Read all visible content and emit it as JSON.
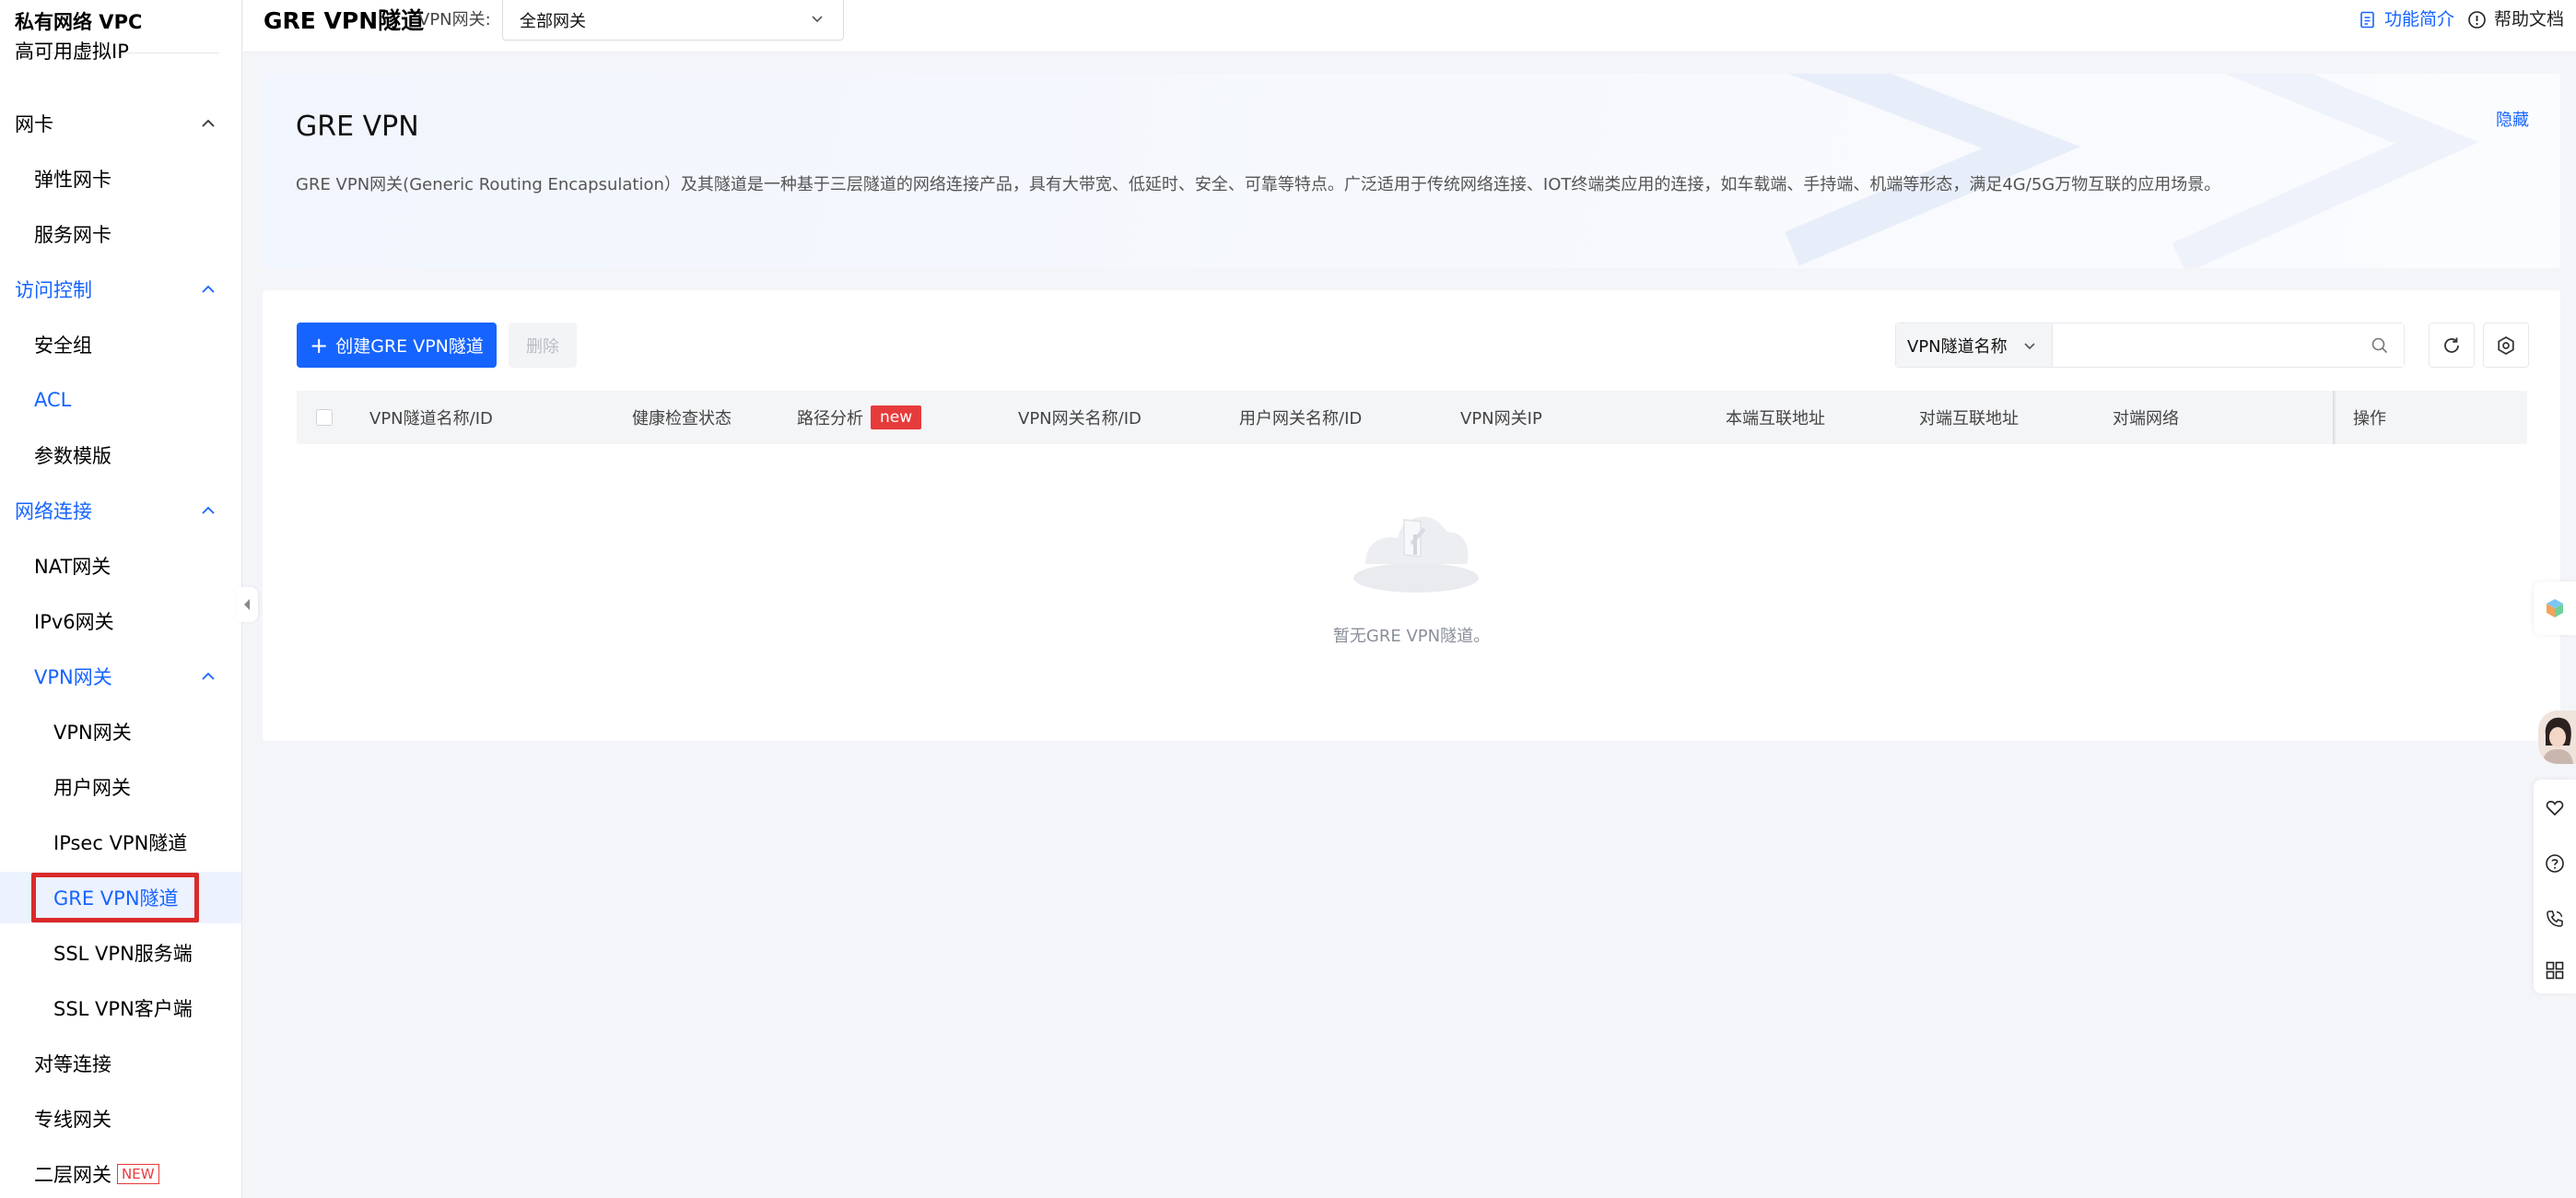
{
  "sidebar": {
    "title": "私有网络 VPC",
    "items": [
      {
        "label": "高可用虚拟IP"
      },
      {
        "label": "网卡"
      },
      {
        "label": "弹性网卡"
      },
      {
        "label": "服务网卡"
      },
      {
        "label": "访问控制"
      },
      {
        "label": "安全组"
      },
      {
        "label": "ACL"
      },
      {
        "label": "参数模版"
      },
      {
        "label": "网络连接"
      },
      {
        "label": "NAT网关"
      },
      {
        "label": "IPv6网关"
      },
      {
        "label": "VPN网关"
      },
      {
        "label": "VPN网关"
      },
      {
        "label": "用户网关"
      },
      {
        "label": "IPsec VPN隧道"
      },
      {
        "label": "GRE VPN隧道"
      },
      {
        "label": "SSL VPN服务端"
      },
      {
        "label": "SSL VPN客户端"
      },
      {
        "label": "对等连接"
      },
      {
        "label": "专线网关"
      },
      {
        "label": "二层网关",
        "badge": "NEW"
      }
    ]
  },
  "header": {
    "title": "GRE VPN隧道",
    "gateway_label": "VPN网关:",
    "gateway_value": "全部网关",
    "intro_link": "功能简介",
    "help_link": "帮助文档"
  },
  "intro": {
    "title": "GRE VPN",
    "hide": "隐藏",
    "description": "GRE VPN网关(Generic Routing Encapsulation）及其隧道是一种基于三层隧道的网络连接产品，具有大带宽、低延时、安全、可靠等特点。广泛适用于传统网络连接、IOT终端类应用的连接，如车载端、手持端、机端等形态，满足4G/5G万物互联的应用场景。"
  },
  "toolbar": {
    "create": "创建GRE VPN隧道",
    "delete": "删除",
    "search_field": "VPN隧道名称",
    "search_placeholder": ""
  },
  "table": {
    "columns": [
      "VPN隧道名称/ID",
      "健康检查状态",
      "路径分析",
      "VPN网关名称/ID",
      "用户网关名称/ID",
      "VPN网关IP",
      "本端互联地址",
      "对端互联地址",
      "对端网络",
      "操作"
    ],
    "new_tag": "new",
    "rows": [],
    "empty": "暂无GRE VPN隧道。"
  },
  "colors": {
    "primary": "#1664ff",
    "danger": "#e63b3b",
    "highlight_box": "#d92a2a",
    "page_bg": "#f4f5f9"
  },
  "icons": {
    "intro_link": "document-icon",
    "help_link": "info-circle-icon",
    "search": "search-icon",
    "refresh": "refresh-icon",
    "settings": "settings-icon",
    "dock": [
      "app-cube-icon",
      "avatar",
      "heart-icon",
      "question-icon",
      "phone-icon",
      "grid-icon"
    ]
  }
}
